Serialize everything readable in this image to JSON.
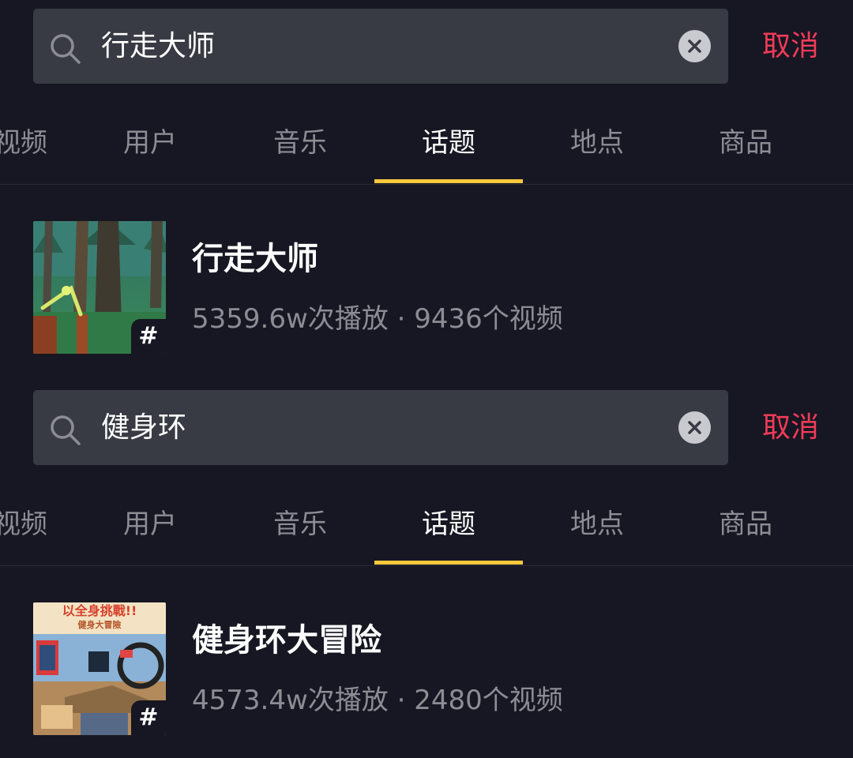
{
  "colors": {
    "background": "#161722",
    "search_box": "#393b44",
    "cancel": "#f23b59",
    "tab_inactive": "#8c8d94",
    "tab_active": "#ffffff",
    "tab_indicator": "#f9c83c",
    "meta_text": "#8c8d94"
  },
  "sections": [
    {
      "search": {
        "query": "行走大师",
        "clear_icon": "clear-icon",
        "cancel_label": "取消"
      },
      "tabs": [
        {
          "label": "视频",
          "active": false
        },
        {
          "label": "用户",
          "active": false
        },
        {
          "label": "音乐",
          "active": false
        },
        {
          "label": "话题",
          "active": true
        },
        {
          "label": "地点",
          "active": false
        },
        {
          "label": "商品",
          "active": false
        }
      ],
      "result": {
        "title": "行走大师",
        "meta": "5359.6w次播放 · 9436个视频",
        "badge": "#"
      }
    },
    {
      "search": {
        "query": "健身环",
        "clear_icon": "clear-icon",
        "cancel_label": "取消"
      },
      "tabs": [
        {
          "label": "视频",
          "active": false
        },
        {
          "label": "用户",
          "active": false
        },
        {
          "label": "音乐",
          "active": false
        },
        {
          "label": "话题",
          "active": true
        },
        {
          "label": "地点",
          "active": false
        },
        {
          "label": "商品",
          "active": false
        }
      ],
      "result": {
        "title": "健身环大冒险",
        "meta": "4573.4w次播放 · 2480个视频",
        "badge": "#",
        "thumb_text": {
          "line1": "以全身挑戰!!",
          "line2": "健身大冒險"
        }
      }
    }
  ]
}
